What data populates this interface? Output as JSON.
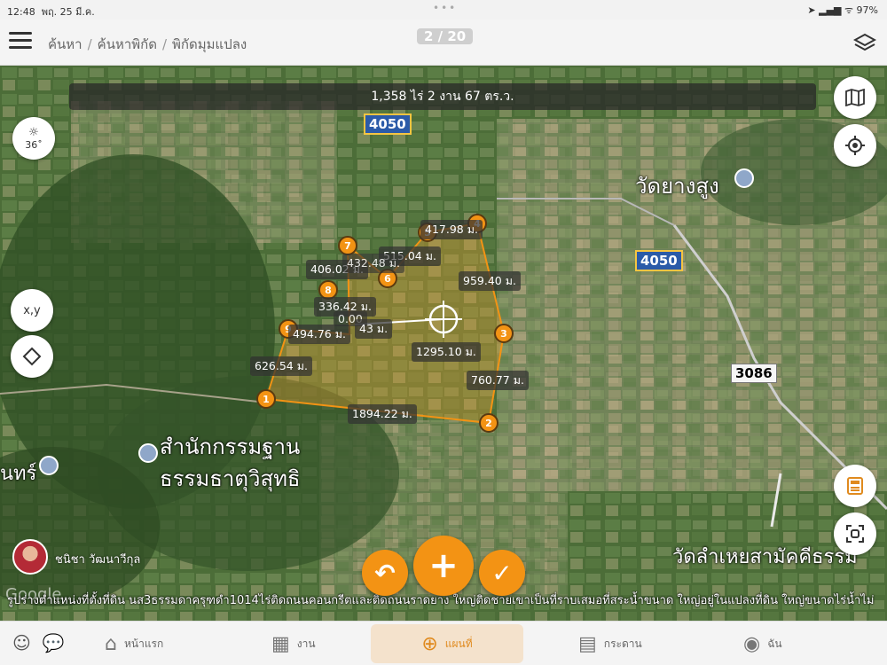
{
  "status": {
    "time": "12:48",
    "date": "พฤ. 25 มี.ค.",
    "battery": "97%",
    "dots": "•••"
  },
  "nav": {
    "breadcrumb": [
      "ค้นหา",
      "ค้นหาพิกัด",
      "พิกัดมุมแปลง"
    ],
    "separator": "/",
    "page_indicator": "2 / 20"
  },
  "map": {
    "area_text": "1,358 ไร่  2 งาน  67 ตร.ว.",
    "sun_angle": "36˚",
    "xy_label": "x,y",
    "roads": [
      "4050",
      "4050",
      "3086"
    ],
    "places": [
      "วัดยางสูง",
      "สำนักกรรมฐาน",
      "ธรรมธาตุวิสุทธิ",
      "นทร์",
      "วัดลำเหยสามัคคีธรรม"
    ],
    "points": [
      "1",
      "2",
      "3",
      "4",
      "5",
      "6",
      "7",
      "8",
      "9"
    ],
    "distances": [
      "417.98 ม.",
      "515.04 ม.",
      "406.02 ม.",
      "432.48 ม.",
      "959.40 ม.",
      "336.42 ม.",
      "0.00",
      "494.76 ม.",
      "43 ม.",
      "1295.10 ม.",
      "626.54 ม.",
      "760.77 ม.",
      "1894.22 ม."
    ],
    "google": "Google",
    "colors": {
      "parcel_outline": "#f39314",
      "parcel_fill": "#f0a030",
      "fab": "#f39314"
    }
  },
  "user": {
    "name": "ชนิชา วัฒนาวีกุล"
  },
  "caption": "รูปร่างตำแหน่งที่ตั้งที่ดิน นส3ธรรมดาครุฑดำ1014ไร่ติดถนนคอนกรีตและติดถนนราดยาง ใหญ่ติดชายเขาเป็นที่ราบเสมอที่สระน้ำขนาด ใหญ่อยู่ในแปลงที่ดิน ใหญ่ขนาดไร่น้ำไม่",
  "tabs": [
    {
      "label": "หน้าแรก",
      "icon": "home-icon"
    },
    {
      "label": "งาน",
      "icon": "calendar-icon"
    },
    {
      "label": "แผนที่",
      "icon": "map-plus-icon"
    },
    {
      "label": "กระดาน",
      "icon": "board-icon"
    },
    {
      "label": "ฉัน",
      "icon": "user-icon"
    }
  ]
}
